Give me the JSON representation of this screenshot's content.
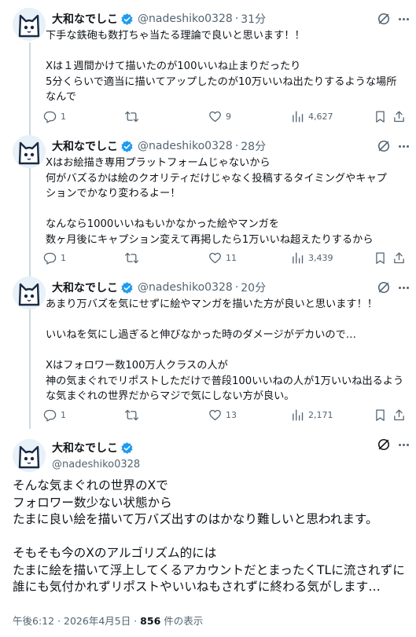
{
  "author": {
    "display_name": "大和なでしこ",
    "handle": "@nadeshiko0328"
  },
  "tweets": [
    {
      "time": "31分",
      "lines": [
        "下手な鉄砲も数打ちゃ当たる理論で良いと思います！！",
        "",
        "Xは１週間かけて描いたのが100いいね止まりだったり",
        "5分くらいで適当に描いてアップしたのが10万いいね出たりするような場所",
        "なんで"
      ],
      "replies": "1",
      "reposts": "",
      "likes": "9",
      "views": "4,627"
    },
    {
      "time": "28分",
      "lines": [
        "Xはお絵描き専用プラットフォームじゃないから",
        "何がバズるかは絵のクオリティだけじゃなく投稿するタイミングやキャプ",
        "ションでかなり変わるよー！",
        "",
        "なんなら1000いいねもいかなかった絵やマンガを",
        "数ヶ月後にキャプション変えて再掲したら1万いいね超えたりするから"
      ],
      "replies": "1",
      "reposts": "",
      "likes": "11",
      "views": "3,439"
    },
    {
      "time": "20分",
      "lines": [
        "あまり万バズを気にせずに絵やマンガを描いた方が良いと思います！！",
        "",
        "いいねを気にし過ぎると伸びなかった時のダメージがデカいので…",
        "",
        "Xはフォロワー数100万人クラスの人が",
        "神の気まぐれでリポストしただけで普段100いいねの人が1万いいね出るよう",
        "な気まぐれの世界だからマジで気にしない方が良い。"
      ],
      "replies": "1",
      "reposts": "",
      "likes": "13",
      "views": "2,171"
    }
  ],
  "main_tweet": {
    "lines": [
      "そんな気まぐれの世界のXで",
      "フォロワー数少ない状態から",
      "たまに良い絵を描いて万バズ出すのはかなり難しいと思われます。",
      "",
      "そもそも今のXのアルゴリズム的には",
      "たまに絵を描いて浮上してくるアカウントだとまったくTLに流されずに",
      "誰にも気付かれずリポストやいいねもされずに終わる気がします…"
    ],
    "time": "午後6:12",
    "date": "2026年4月5日",
    "views_count": "856",
    "views_label": "件の表示"
  },
  "colors": {
    "verified": "#1d9bf0",
    "text": "#0f1419",
    "secondary": "#536471",
    "thread_line": "#cfd9de"
  },
  "icons": {
    "reply": "reply-icon",
    "repost": "repost-icon",
    "like": "heart-icon",
    "views": "views-icon",
    "bookmark": "bookmark-icon",
    "share": "share-icon",
    "grok": "grok-icon",
    "more": "more-icon",
    "verified": "verified-badge-icon"
  }
}
